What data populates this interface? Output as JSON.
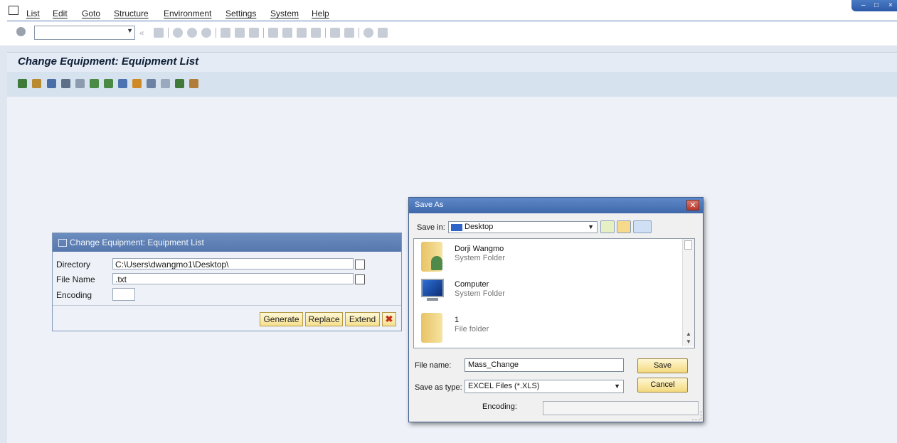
{
  "menubar": {
    "items": [
      "List",
      "Edit",
      "Goto",
      "Structure",
      "Environment",
      "Settings",
      "System",
      "Help"
    ]
  },
  "toolbar": {
    "command_field_value": ""
  },
  "screen": {
    "title": "Change Equipment: Equipment List"
  },
  "export_dialog": {
    "title": "Change Equipment: Equipment List",
    "directory_label": "Directory",
    "directory_value": "C:\\Users\\dwangmo1\\Desktop\\",
    "file_name_label": "File Name",
    "file_name_value": ".txt",
    "encoding_label": "Encoding",
    "encoding_value": "",
    "generate_label": "Generate",
    "replace_label": "Replace",
    "extend_label": "Extend"
  },
  "save_as": {
    "title": "Save As",
    "save_in_label": "Save in:",
    "save_in_value": "Desktop",
    "items": [
      {
        "name": "Dorji Wangmo",
        "type": "System Folder"
      },
      {
        "name": "Computer",
        "type": "System Folder"
      },
      {
        "name": "1",
        "type": "File folder"
      }
    ],
    "file_name_label": "File name:",
    "file_name_value": "Mass_Change",
    "save_as_type_label": "Save as type:",
    "save_as_type_value": "EXCEL Files (*.XLS)",
    "encoding_label": "Encoding:",
    "save_label": "Save",
    "cancel_label": "Cancel"
  }
}
